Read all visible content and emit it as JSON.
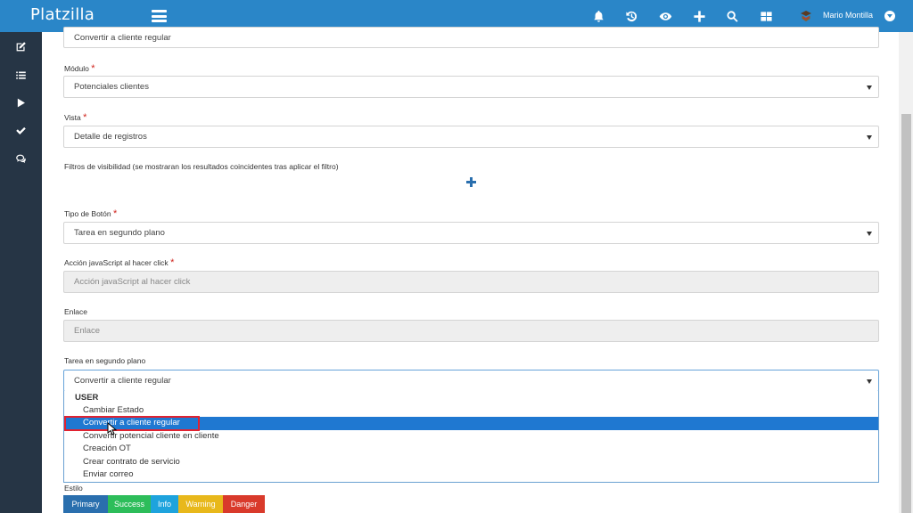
{
  "app": {
    "brand": "Platzilla",
    "user_name": "Mario Montilla"
  },
  "topbar_icons": [
    "bell-icon",
    "history-icon",
    "eye-icon",
    "plus-icon",
    "search-icon",
    "grid-icon"
  ],
  "sidebar_icons": [
    "edit-icon",
    "list-icon",
    "play-icon",
    "check-icon",
    "chat-icon"
  ],
  "form": {
    "name_value": "Convertir a cliente regular",
    "modulo_label": "Módulo",
    "modulo_value": "Potenciales clientes",
    "vista_label": "Vista",
    "vista_value": "Detalle de registros",
    "filtros_label": "Filtros de visibilidad (se mostraran los resultados coincidentes tras aplicar el filtro)",
    "tipo_label": "Tipo de Botón",
    "tipo_value": "Tarea en segundo plano",
    "accion_label": "Acción javaScript al hacer click",
    "accion_placeholder": "Acción javaScript al hacer click",
    "enlace_label": "Enlace",
    "enlace_placeholder": "Enlace",
    "tarea_label": "Tarea en segundo plano",
    "tarea_value": "Convertir a cliente regular",
    "required_mark": "*",
    "estilo_label": "Estilo"
  },
  "dropdown": {
    "group_label": "USER",
    "options": [
      "Cambiar Estado",
      "Convertir a cliente regular",
      "Convertir potencial cliente en cliente",
      "Creación OT",
      "Crear contrato de servicio",
      "Enviar correo"
    ],
    "selected": "Convertir a cliente regular"
  },
  "style_buttons": [
    {
      "label": "Primary",
      "color": "#2a6fae"
    },
    {
      "label": "Success",
      "color": "#2dbd5a"
    },
    {
      "label": "Info",
      "color": "#1ea3dd"
    },
    {
      "label": "Warning",
      "color": "#e8b81b"
    },
    {
      "label": "Danger",
      "color": "#d93a2b"
    }
  ],
  "colors": {
    "topbar": "#2a86c8",
    "sidebar": "#263545",
    "accent": "#1f78d1",
    "required": "#d0261f",
    "highlight_box": "#e12230"
  }
}
